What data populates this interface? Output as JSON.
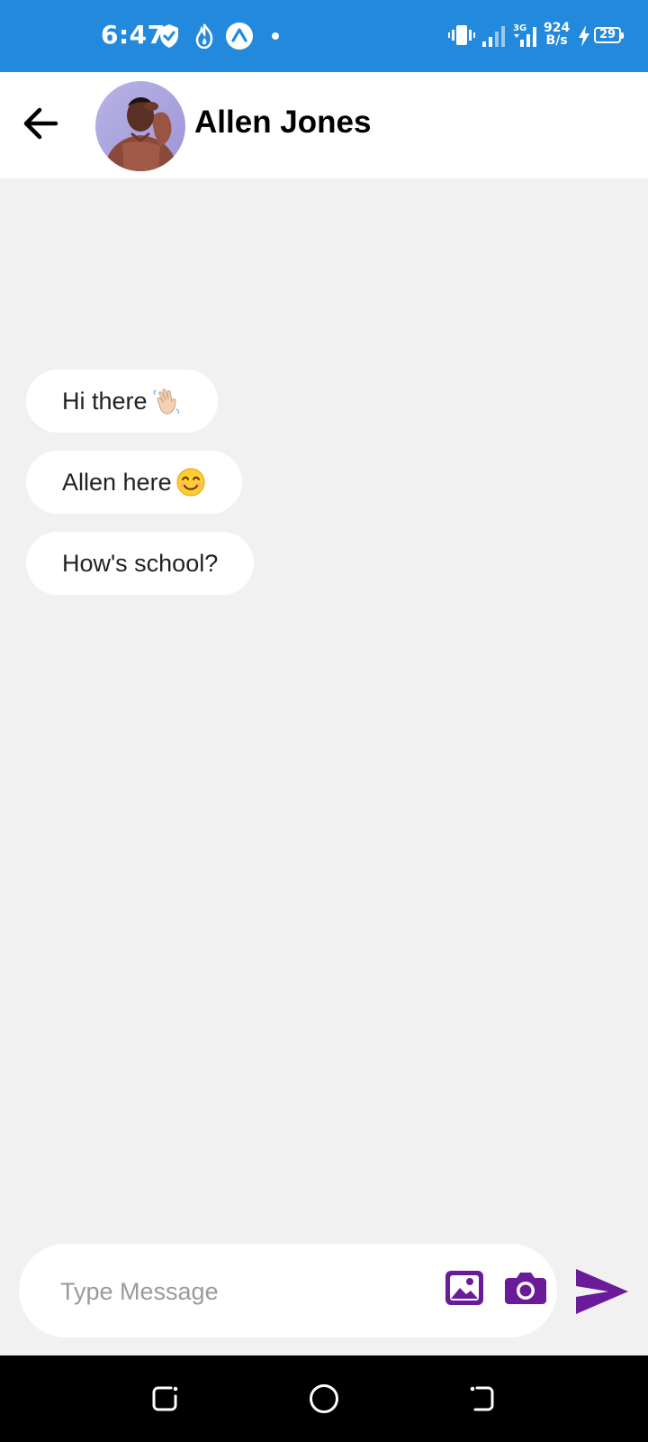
{
  "status_bar": {
    "time": "6:47",
    "network_speed_value": "924",
    "network_speed_unit": "B/s",
    "battery_level": "29",
    "background_color": "#2389dd",
    "icons": [
      "shield-check-icon",
      "flame-icon",
      "app-a-icon",
      "dot-icon",
      "vibrate-icon",
      "signal-icon",
      "signal-3g-icon",
      "charging-icon",
      "battery-icon"
    ]
  },
  "header": {
    "contact_name": "Allen Jones",
    "back_icon": "arrow-left-icon"
  },
  "messages": [
    {
      "text": "Hi there",
      "emoji": "waving-hand-emoji"
    },
    {
      "text": "Allen here ",
      "emoji": "smiling-face-emoji"
    },
    {
      "text": "How's school?",
      "emoji": ""
    }
  ],
  "composer": {
    "placeholder": "Type Message",
    "value": "",
    "gallery_icon": "image-gallery-icon",
    "camera_icon": "camera-icon",
    "send_icon": "send-icon",
    "accent_color": "#6a1b9a"
  },
  "nav_bar": {
    "icons": [
      "recents-icon",
      "home-icon",
      "back-icon"
    ]
  }
}
